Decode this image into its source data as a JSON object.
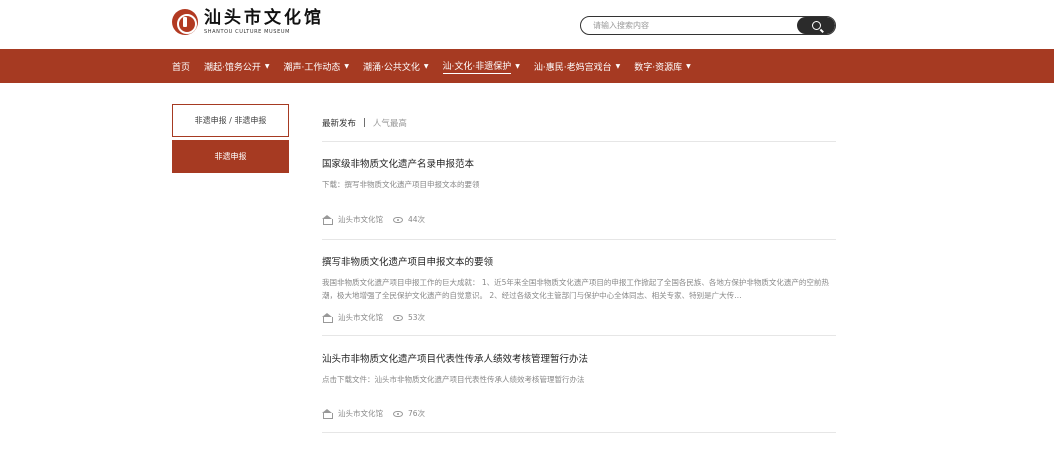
{
  "header": {
    "logo_cn": "汕头市文化馆",
    "logo_en": "SHANTOU CULTURE MUSEUM",
    "search_placeholder": "请输入搜索内容"
  },
  "nav": [
    {
      "label": "首页",
      "caret": ""
    },
    {
      "label": "潮起·馆务公开",
      "caret": "▼"
    },
    {
      "label": "潮声·工作动态",
      "caret": "▼"
    },
    {
      "label": "潮涌·公共文化",
      "caret": "▼"
    },
    {
      "label": "汕·文化·非遗保护",
      "caret": "▼"
    },
    {
      "label": "汕·惠民·老妈宫戏台",
      "caret": "▼"
    },
    {
      "label": "数字·资源库",
      "caret": "▼"
    }
  ],
  "sidebar": {
    "title": "非遗申报 / 非遗申报",
    "items": [
      "非遗申报"
    ]
  },
  "sort_tabs": {
    "latest": "最新发布",
    "separator": "|",
    "popular": "人气最高"
  },
  "articles": [
    {
      "title": "国家级非物质文化遗产名录申报范本",
      "summary": "下载：撰写非物质文化遗产项目申报文本的要领",
      "source": "汕头市文化馆",
      "views": "44次"
    },
    {
      "title": "撰写非物质文化遗产项目申报文本的要领",
      "summary": "我国非物质文化遗产项目申报工作的巨大成就：  1、近5年来全国非物质文化遗产项目的申报工作掀起了全国各民族、各地方保护非物质文化遗产的空前热潮，极大地增强了全民保护文化遗产的自觉意识。  2、经过各级文化主管部门与保护中心全体同志、相关专家、特别是广大传…",
      "source": "汕头市文化馆",
      "views": "53次"
    },
    {
      "title": "汕头市非物质文化遗产项目代表性传承人绩效考核管理暂行办法",
      "summary": "点击下载文件：汕头市非物质文化遗产项目代表性传承人绩效考核管理暂行办法",
      "source": "汕头市文化馆",
      "views": "76次"
    }
  ],
  "colors": {
    "brand": "#a63a22",
    "search_button": "#2b2b2b"
  }
}
